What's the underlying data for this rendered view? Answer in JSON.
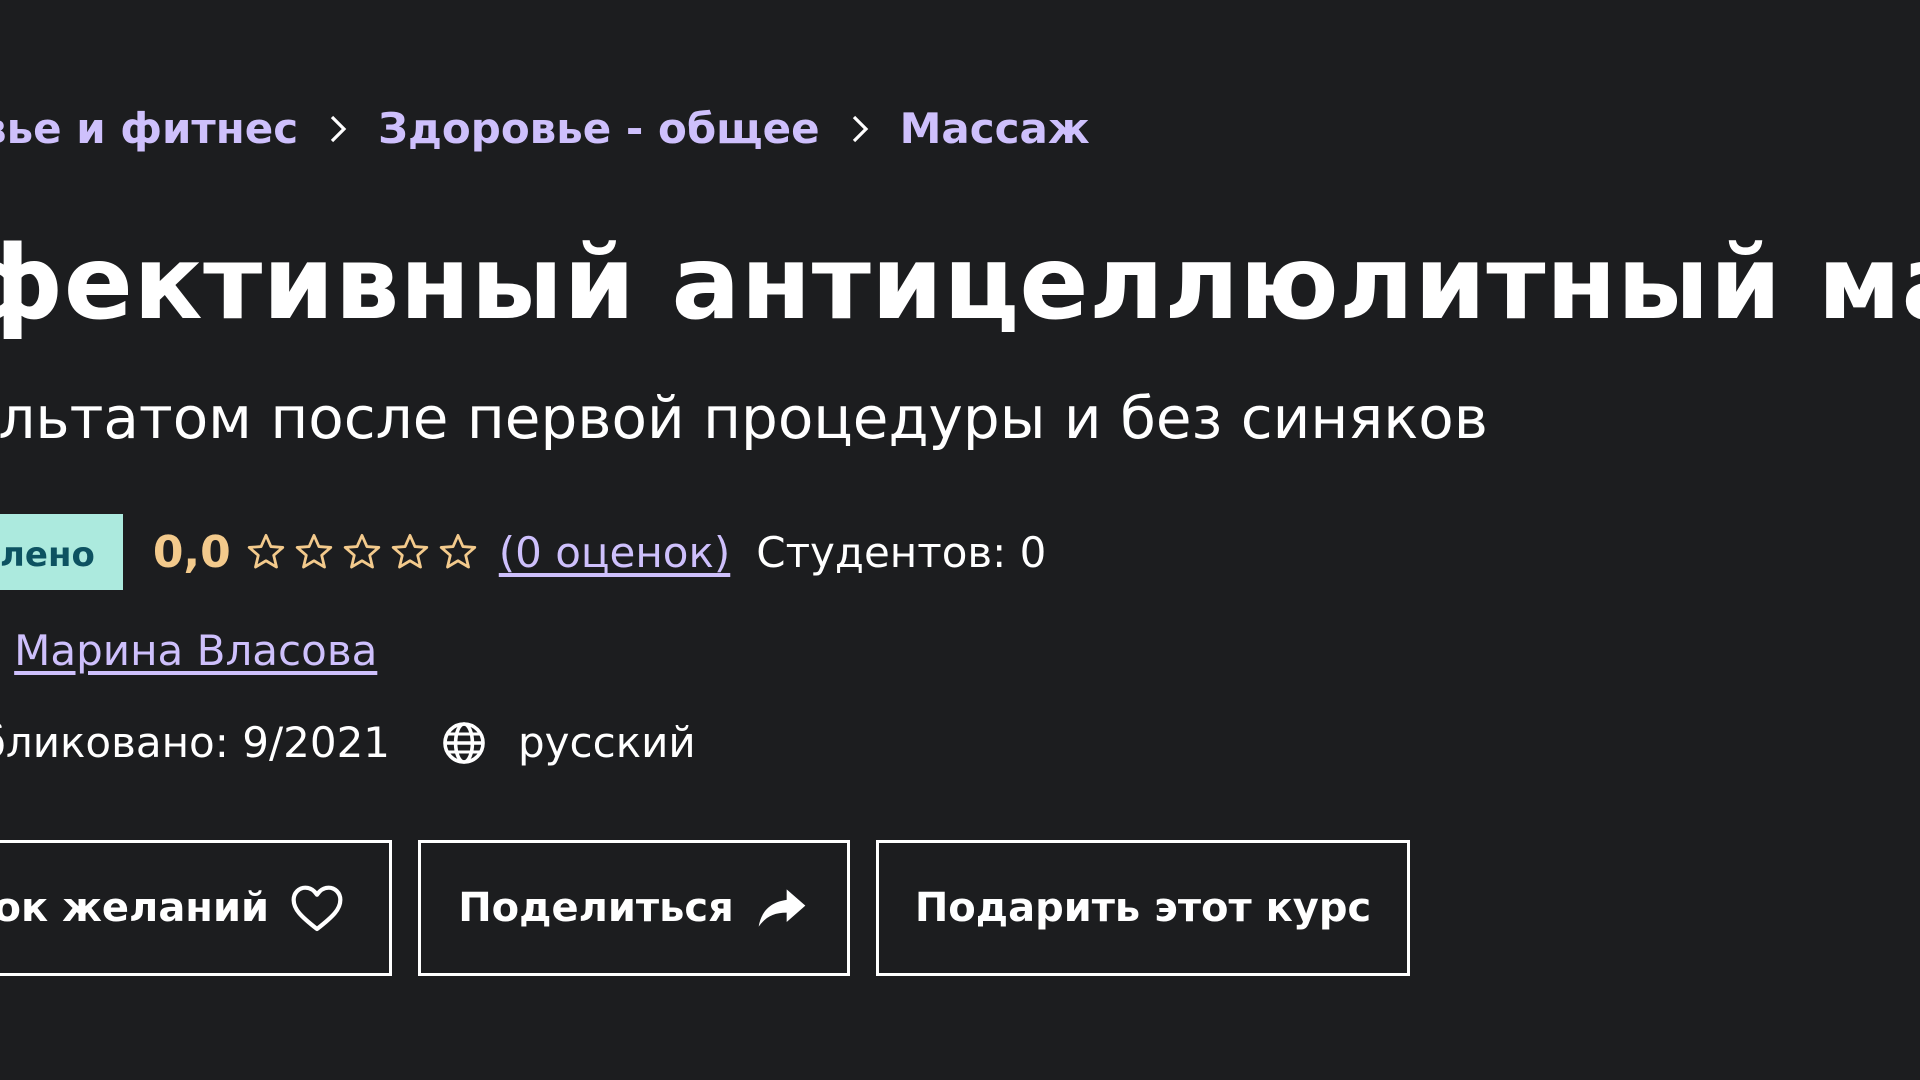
{
  "breadcrumb": {
    "items": [
      {
        "label": "вье и фитнес"
      },
      {
        "label": "Здоровье - общее"
      },
      {
        "label": "Массаж"
      }
    ]
  },
  "course": {
    "title": "фективный антицеллюлитный масса",
    "subtitle": "ультатом после первой процедуры и без синяков",
    "badge": "лено",
    "rating_value": "0,0",
    "rating_stars": {
      "value": 0,
      "max": 5
    },
    "ratings_count_link": "(0 оценок)",
    "students": "Студентов: 0",
    "author_prefix": ":",
    "author_name": "Марина Власова",
    "published": "бликовано: 9/2021",
    "language": "русский"
  },
  "actions": {
    "wishlist_label": "ок желаний",
    "share_label": "Поделиться",
    "gift_label": "Подарить этот курс"
  },
  "icons": {
    "breadcrumb_separator": "chevron-right-icon",
    "star": "star-outline-icon",
    "language": "globe-icon",
    "wishlist": "heart-outline-icon",
    "share": "share-arrow-icon"
  },
  "colors": {
    "background": "#1c1d1f",
    "link": "#cec0fc",
    "rating": "#f3ca8c",
    "badge_bg": "#aceade",
    "badge_text": "#0d5261",
    "text": "#ffffff"
  }
}
